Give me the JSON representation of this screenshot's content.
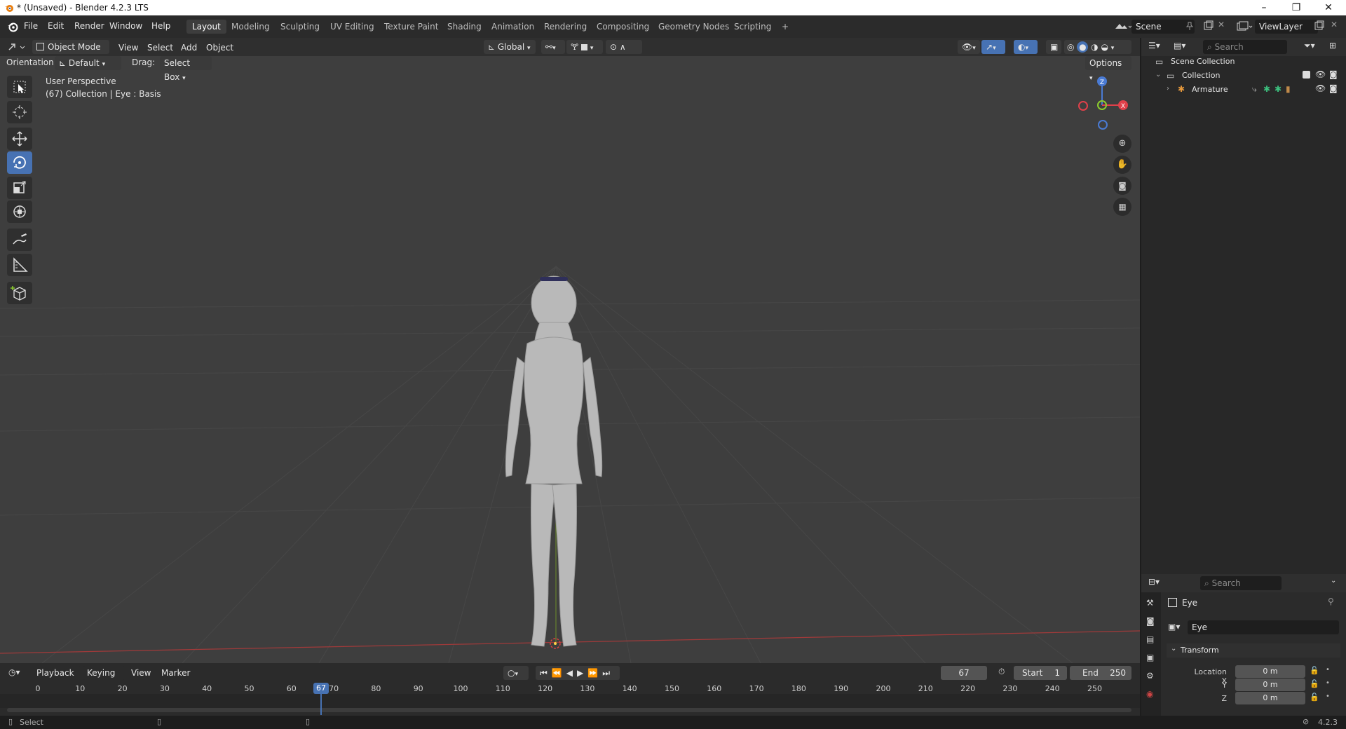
{
  "window": {
    "title": "* (Unsaved) - Blender 4.2.3 LTS",
    "min": "–",
    "max": "❐",
    "close": "✕"
  },
  "menu": [
    "File",
    "Edit",
    "Render",
    "Window",
    "Help"
  ],
  "workspaces": [
    "Layout",
    "Modeling",
    "Sculpting",
    "UV Editing",
    "Texture Paint",
    "Shading",
    "Animation",
    "Rendering",
    "Compositing",
    "Geometry Nodes",
    "Scripting",
    "+"
  ],
  "scene": {
    "name": "Scene",
    "view_layer": "ViewLayer"
  },
  "viewport_header": {
    "mode": "Object Mode",
    "view": "View",
    "select": "Select",
    "add": "Add",
    "object": "Object",
    "transform_orientation": "Global",
    "orientation_label": "Orientation:",
    "orientation_value": "Default",
    "drag_label": "Drag:",
    "drag_value": "Select Box",
    "options": "Options"
  },
  "viewport_overlay": {
    "line1": "User Perspective",
    "line2": "(67) Collection | Eye : Basis"
  },
  "gizmo": {
    "z": "Z",
    "x": "X"
  },
  "outliner": {
    "search_placeholder": "Search",
    "items": [
      {
        "label": "Scene Collection"
      },
      {
        "label": "Collection"
      },
      {
        "label": "Armature"
      }
    ]
  },
  "properties": {
    "search_placeholder": "Search",
    "object_name": "Eye",
    "data_name": "Eye",
    "panel": "Transform",
    "location_x_label": "Location X",
    "location_x": "0 m",
    "location_y_label": "Y",
    "location_y": "0 m",
    "location_z_label": "Z",
    "location_z": "0 m"
  },
  "timeline": {
    "playback": "Playback",
    "keying": "Keying",
    "view": "View",
    "marker": "Marker",
    "current_frame": "67",
    "start_label": "Start",
    "start": "1",
    "end_label": "End",
    "end": "250",
    "playhead": "67",
    "ticks": [
      "0",
      "10",
      "20",
      "30",
      "40",
      "50",
      "60",
      "70",
      "80",
      "90",
      "100",
      "110",
      "120",
      "130",
      "140",
      "150",
      "160",
      "170",
      "180",
      "190",
      "200",
      "210",
      "220",
      "230",
      "240",
      "250"
    ]
  },
  "status": {
    "left": "Select",
    "version": "4.2.3"
  },
  "colors": {
    "accent": "#4772b3",
    "viewport_bg": "#3e3e3e",
    "x_axis": "#e0404a",
    "y_axis": "#8ccc2e",
    "z_axis": "#4a7bd4"
  }
}
